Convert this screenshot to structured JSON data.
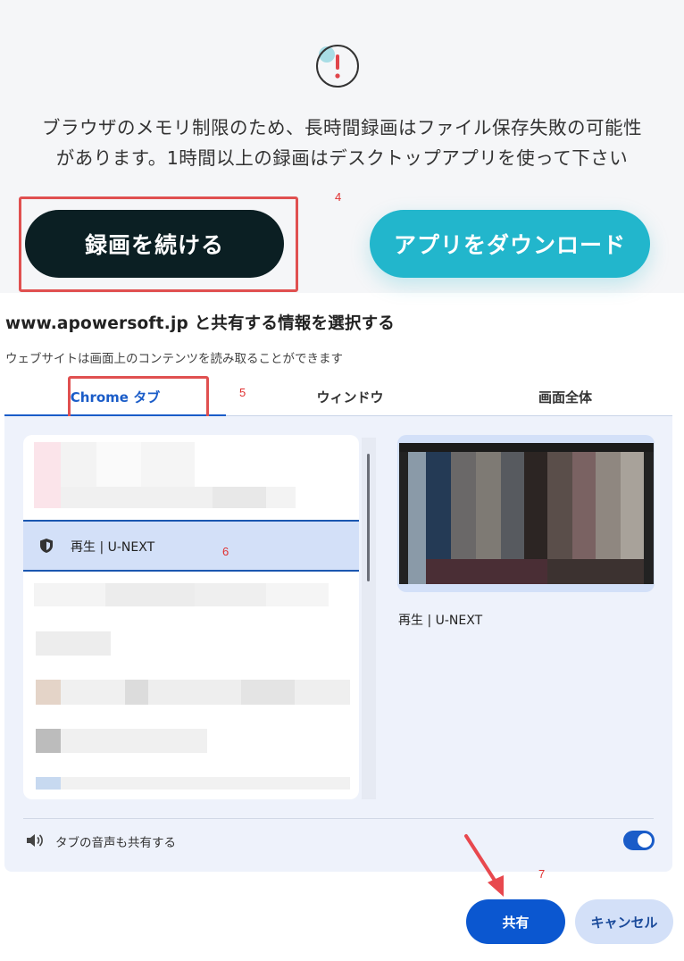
{
  "notice": {
    "message_line1": "ブラウザのメモリ制限のため、長時間録画はファイル保存失敗の可能性",
    "message_line2": "があります。1時間以上の録画はデスクトップアプリを使って下さい",
    "continue_label": "録画を続ける",
    "download_label": "アプリをダウンロード"
  },
  "annotations": {
    "step4": "4",
    "step5": "5",
    "step6": "6",
    "step7": "7"
  },
  "dialog": {
    "title": "www.apowersoft.jp と共有する情報を選択する",
    "subtitle": "ウェブサイトは画面上のコンテンツを読み取ることができます",
    "tabs": [
      {
        "label": "Chrome タブ",
        "active": true
      },
      {
        "label": "ウィンドウ",
        "active": false
      },
      {
        "label": "画面全体",
        "active": false
      }
    ],
    "selected_tab_item": "再生 | U-NEXT",
    "preview_label": "再生 | U-NEXT",
    "audio_label": "タブの音声も共有する",
    "audio_enabled": true,
    "share_label": "共有",
    "cancel_label": "キャンセル"
  },
  "colors": {
    "accent": "#1a5cc8",
    "annotation": "#e05050",
    "continue_bg": "#0b1f23",
    "download_bg": "#22b6cc"
  }
}
